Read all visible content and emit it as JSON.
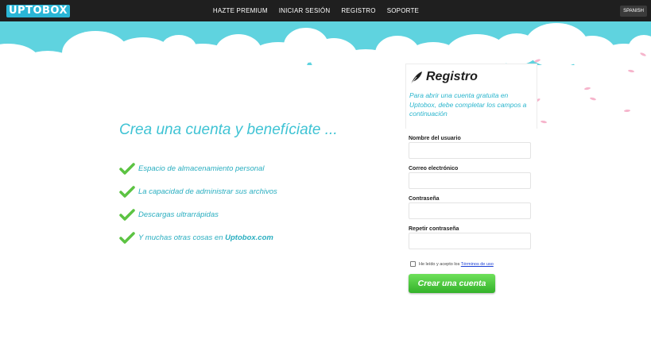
{
  "app": {
    "logo_text": "UPTOBOX",
    "language": "SPANISH"
  },
  "nav": {
    "items": [
      "HAZTE PREMIUM",
      "INICIAR SESIÓN",
      "REGISTRO",
      "SOPORTE"
    ]
  },
  "hero": {
    "headline": "Crea una cuenta y benefíciate ...",
    "features": [
      "Espacio de almacenamiento personal",
      "La capacidad de administrar sus archivos",
      "Descargas ultrarrápidas"
    ],
    "last_feature_prefix": "Y muchas otras cosas en ",
    "last_feature_brand": "Uptobox.com"
  },
  "form": {
    "title": "Registro",
    "description": "Para abrir una cuenta gratuita en Uptobox, debe completar los campos a continuación",
    "username_label": "Nombre del usuario",
    "email_label": "Correo electrónico",
    "password_label": "Contraseña",
    "repeat_password_label": "Repetir contraseña",
    "terms_prefix": "He leído y acepto los ",
    "terms_link": "Términos de uso",
    "submit_label": "Crear una cuenta"
  },
  "colors": {
    "topbar": "#1f1f1f",
    "sky": "#5fd3df",
    "accent": "#3fc3d4",
    "check": "#5cc342",
    "button": "#45c136"
  }
}
